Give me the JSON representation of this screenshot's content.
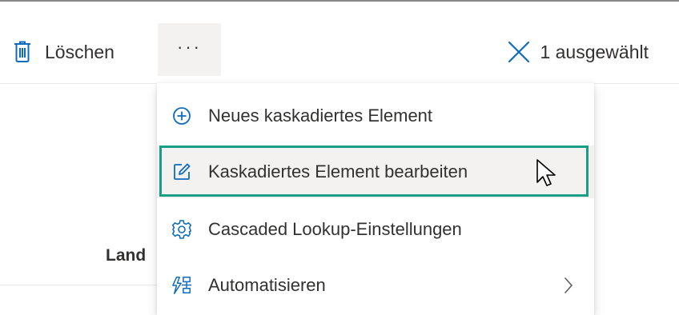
{
  "commandbar": {
    "delete_label": "Löschen",
    "more_label": "···",
    "selection_label": "1 ausgewählt"
  },
  "list": {
    "column_header": "Land"
  },
  "menu": {
    "items": [
      {
        "label": "Neues kaskadiertes Element",
        "icon": "add-circle-icon"
      },
      {
        "label": "Kaskadiertes Element bearbeiten",
        "icon": "edit-icon"
      },
      {
        "label": "Cascaded Lookup-Einstellungen",
        "icon": "gear-icon"
      },
      {
        "label": "Automatisieren",
        "icon": "automate-icon",
        "has_submenu": true
      }
    ]
  },
  "colors": {
    "accent": "#0f6cbd",
    "highlight_border": "#17a085",
    "text": "#323130",
    "hover_bg": "#f3f2f1"
  }
}
